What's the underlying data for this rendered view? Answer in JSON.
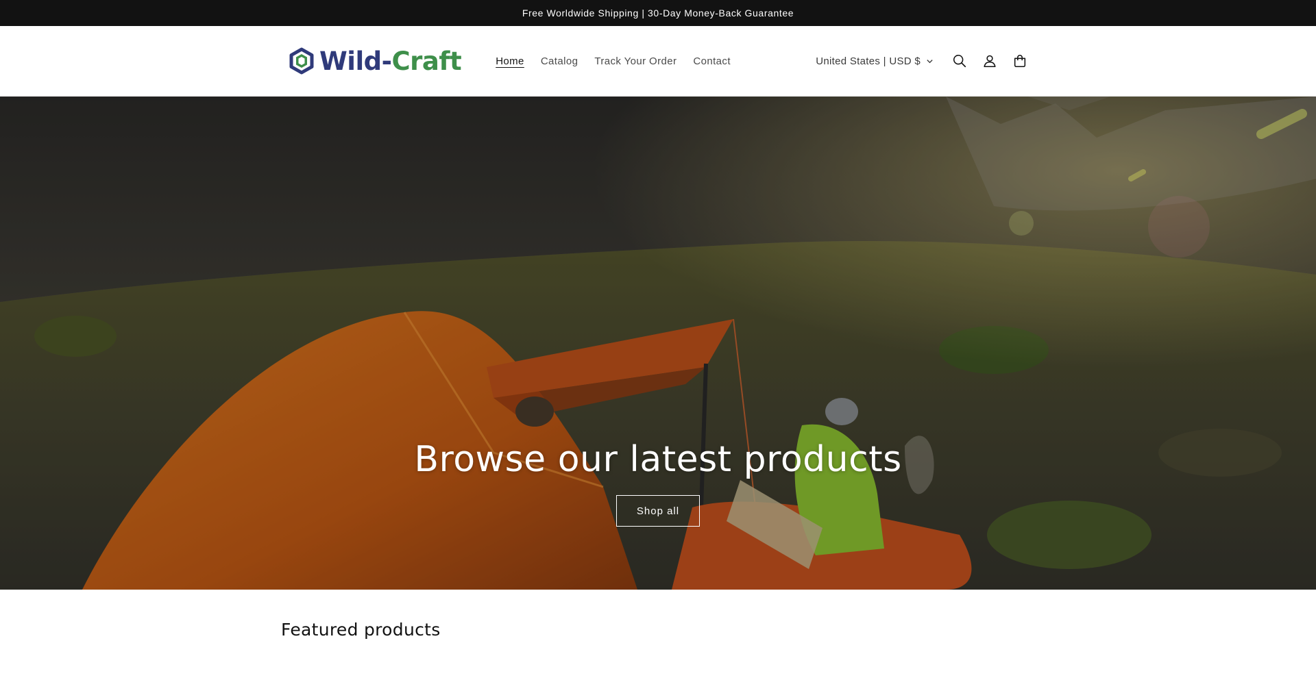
{
  "announcement": {
    "text": "Free Worldwide Shipping | 30-Day Money-Back Guarantee"
  },
  "header": {
    "logo": {
      "part1": "Wild-",
      "part2": "Craft",
      "colors": {
        "primary": "#2f3a7a",
        "secondary": "#3e8f4a"
      }
    },
    "nav": [
      {
        "label": "Home",
        "active": true
      },
      {
        "label": "Catalog",
        "active": false
      },
      {
        "label": "Track Your Order",
        "active": false
      },
      {
        "label": "Contact",
        "active": false
      }
    ],
    "country_selector": "United States | USD $",
    "icons": [
      "search-icon",
      "account-icon",
      "cart-icon",
      "chevron-down-icon"
    ]
  },
  "hero": {
    "title": "Browse our latest products",
    "button_label": "Shop all"
  },
  "featured": {
    "title": "Featured products"
  }
}
